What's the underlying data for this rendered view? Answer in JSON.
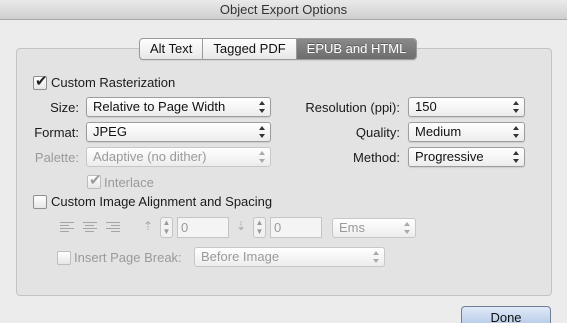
{
  "window": {
    "title": "Object Export Options"
  },
  "tabs": [
    {
      "label": "Alt Text",
      "active": false
    },
    {
      "label": "Tagged PDF",
      "active": false
    },
    {
      "label": "EPUB and HTML",
      "active": true
    }
  ],
  "custom_rasterization": {
    "label": "Custom Rasterization",
    "checked": true
  },
  "size": {
    "label": "Size:",
    "value": "Relative to Page Width"
  },
  "format": {
    "label": "Format:",
    "value": "JPEG"
  },
  "palette": {
    "label": "Palette:",
    "value": "Adaptive (no dither)",
    "disabled": true
  },
  "interlace": {
    "label": "Interlace",
    "checked": true,
    "disabled": true
  },
  "resolution": {
    "label": "Resolution (ppi):",
    "value": "150"
  },
  "quality": {
    "label": "Quality:",
    "value": "Medium"
  },
  "method": {
    "label": "Method:",
    "value": "Progressive"
  },
  "custom_alignment": {
    "label": "Custom Image Alignment and Spacing",
    "checked": false
  },
  "spacing": {
    "before_value": "0",
    "after_value": "0",
    "units": "Ems"
  },
  "page_break": {
    "label": "Insert Page Break:",
    "value": "Before Image",
    "checked": false
  },
  "footer": {
    "done_label": "Done"
  }
}
